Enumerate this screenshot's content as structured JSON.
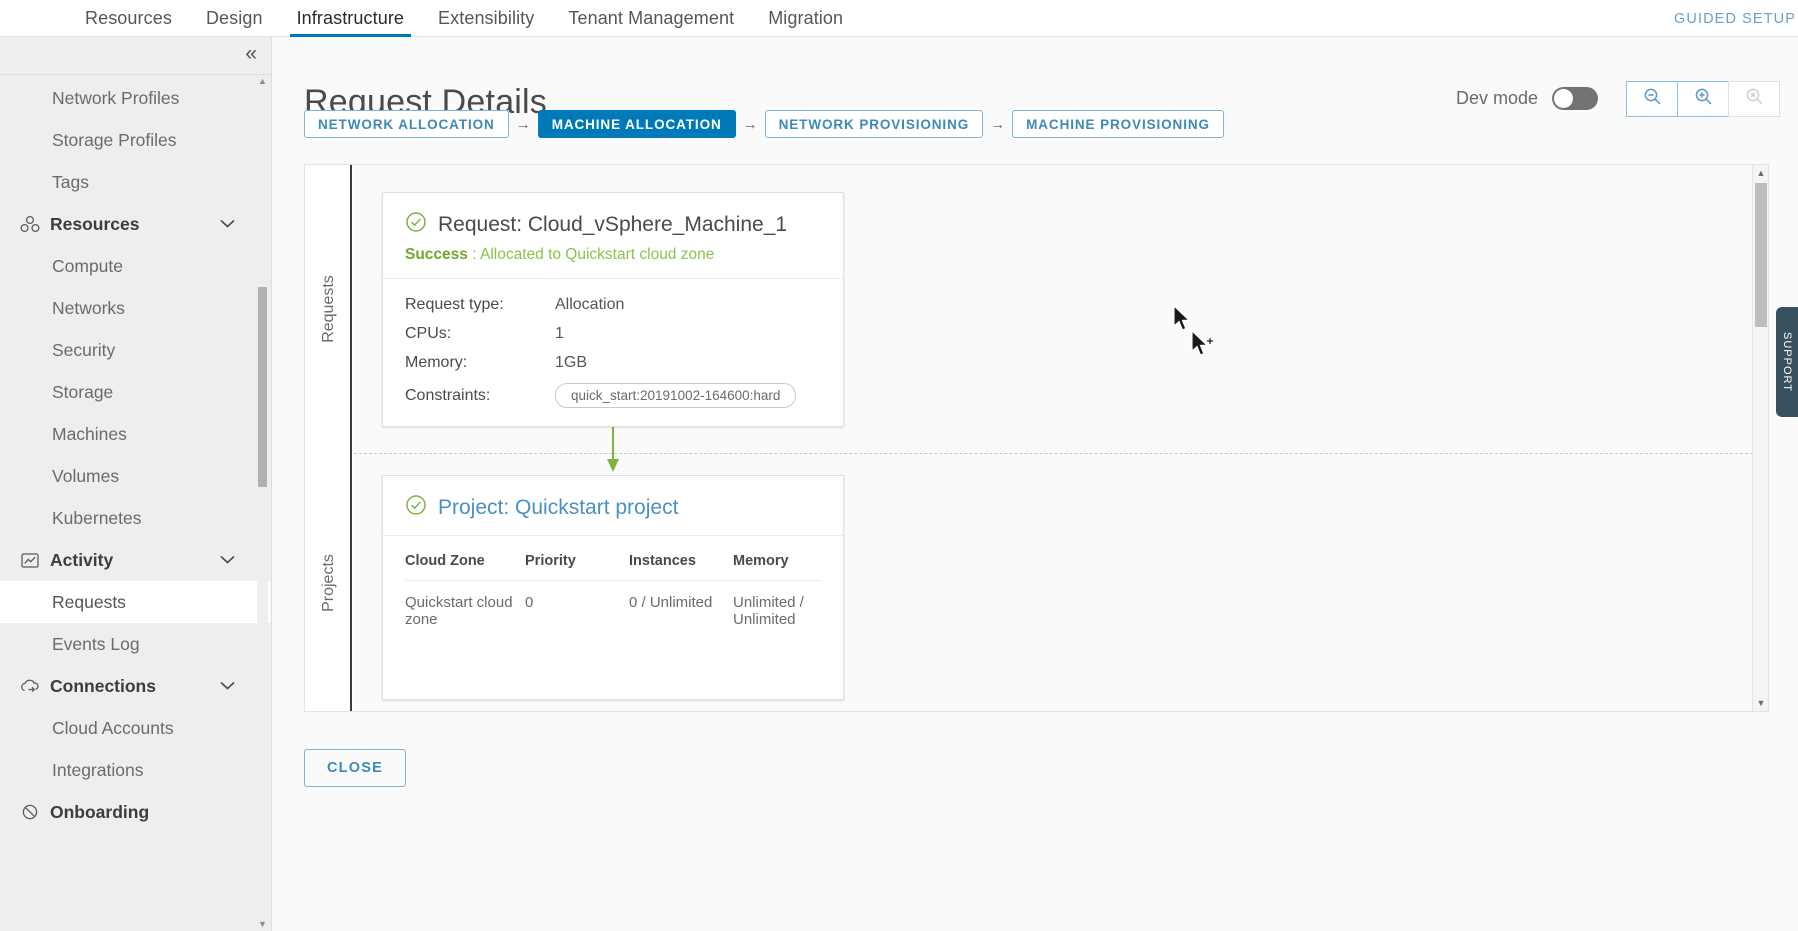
{
  "topnav": {
    "items": [
      {
        "label": "Resources",
        "active": false
      },
      {
        "label": "Design",
        "active": false
      },
      {
        "label": "Infrastructure",
        "active": true
      },
      {
        "label": "Extensibility",
        "active": false
      },
      {
        "label": "Tenant Management",
        "active": false
      },
      {
        "label": "Migration",
        "active": false
      }
    ],
    "guided_setup": "GUIDED SETUP"
  },
  "sidebar": {
    "collapse_icon": "«",
    "items": [
      {
        "label": "Network Profiles",
        "type": "child",
        "selected": false
      },
      {
        "label": "Storage Profiles",
        "type": "child",
        "selected": false
      },
      {
        "label": "Tags",
        "type": "child",
        "selected": false
      },
      {
        "label": "Resources",
        "type": "group",
        "selected": false,
        "icon": "resources-icon",
        "expanded": true
      },
      {
        "label": "Compute",
        "type": "child",
        "selected": false
      },
      {
        "label": "Networks",
        "type": "child",
        "selected": false
      },
      {
        "label": "Security",
        "type": "child",
        "selected": false
      },
      {
        "label": "Storage",
        "type": "child",
        "selected": false
      },
      {
        "label": "Machines",
        "type": "child",
        "selected": false
      },
      {
        "label": "Volumes",
        "type": "child",
        "selected": false
      },
      {
        "label": "Kubernetes",
        "type": "child",
        "selected": false
      },
      {
        "label": "Activity",
        "type": "group",
        "selected": false,
        "icon": "activity-icon",
        "expanded": true
      },
      {
        "label": "Requests",
        "type": "child",
        "selected": true
      },
      {
        "label": "Events Log",
        "type": "child",
        "selected": false
      },
      {
        "label": "Connections",
        "type": "group",
        "selected": false,
        "icon": "connections-icon",
        "expanded": true
      },
      {
        "label": "Cloud Accounts",
        "type": "child",
        "selected": false
      },
      {
        "label": "Integrations",
        "type": "child",
        "selected": false
      },
      {
        "label": "Onboarding",
        "type": "group",
        "selected": false,
        "icon": "onboarding-icon",
        "expanded": false
      }
    ]
  },
  "main": {
    "title": "Request Details",
    "dev_mode": {
      "label": "Dev mode",
      "on": false
    },
    "zoom_controls": [
      {
        "name": "zoom-out",
        "enabled": true
      },
      {
        "name": "zoom-in",
        "enabled": true
      },
      {
        "name": "zoom-reset",
        "enabled": false
      }
    ],
    "steps": [
      {
        "label": "NETWORK ALLOCATION",
        "active": false
      },
      {
        "label": "MACHINE ALLOCATION",
        "active": true
      },
      {
        "label": "NETWORK PROVISIONING",
        "active": false
      },
      {
        "label": "MACHINE PROVISIONING",
        "active": false
      }
    ],
    "step_arrow": "→",
    "close_label": "CLOSE"
  },
  "diagram": {
    "lanes": [
      {
        "label": "Requests"
      },
      {
        "label": "Projects"
      }
    ],
    "request_node": {
      "title": "Request: Cloud_vSphere_Machine_1",
      "status_word": "Success",
      "status_sep": " : ",
      "status_text": "Allocated to Quickstart cloud zone",
      "fields": [
        {
          "key": "Request type:",
          "value": "Allocation",
          "pill": false
        },
        {
          "key": "CPUs:",
          "value": "1",
          "pill": false
        },
        {
          "key": "Memory:",
          "value": "1GB",
          "pill": false
        },
        {
          "key": "Constraints:",
          "value": "quick_start:20191002-164600:hard",
          "pill": true
        }
      ]
    },
    "project_node": {
      "title": "Project: Quickstart project",
      "columns": [
        "Cloud Zone",
        "Priority",
        "Instances",
        "Memory"
      ],
      "rows": [
        [
          "Quickstart cloud zone",
          "0",
          "0 / Unlimited",
          "Unlimited / Unlimited"
        ]
      ]
    },
    "connector_color": "#7cb342"
  },
  "support": {
    "label": "SUPPORT"
  },
  "colors": {
    "accent": "#0079b8",
    "link": "#4a90c4",
    "success": "#8bc34a",
    "sidebar_bg": "#eeeeee",
    "canvas_bg": "#fafafa",
    "support_bg": "#37505e"
  }
}
